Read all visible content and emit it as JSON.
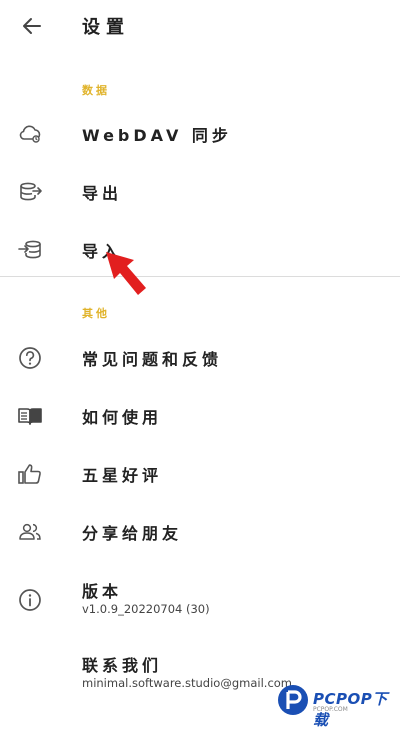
{
  "header": {
    "title": "设置",
    "back_icon": "arrow-left-icon"
  },
  "sections": {
    "data_label": "数据",
    "other_label": "其他"
  },
  "items": {
    "webdav": {
      "label": "WebDAV 同步",
      "icon": "cloud-sync-icon"
    },
    "export": {
      "label": "导出",
      "icon": "database-export-icon"
    },
    "import": {
      "label": "导入",
      "icon": "database-import-icon"
    },
    "faq": {
      "label": "常见问题和反馈",
      "icon": "help-circle-icon"
    },
    "howto": {
      "label": "如何使用",
      "icon": "book-icon"
    },
    "rate": {
      "label": "五星好评",
      "icon": "thumbs-up-icon"
    },
    "share": {
      "label": "分享给朋友",
      "icon": "people-icon"
    },
    "version": {
      "label": "版本",
      "value": "v1.0.9_20220704 (30)",
      "icon": "info-icon"
    },
    "contact": {
      "label": "联系我们",
      "value": "minimal.software.studio@gmail.com"
    }
  },
  "watermark": {
    "brand": "PCPOP下载",
    "tagline": "PCPOP.COM"
  },
  "colors": {
    "section_label": "#e0b32a",
    "annotation_arrow": "#e21f1f",
    "watermark": "#1a4fb4"
  }
}
